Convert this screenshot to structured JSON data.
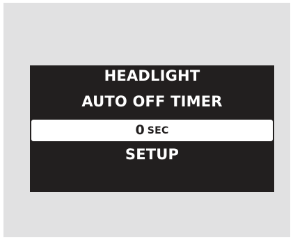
{
  "display": {
    "line1": "HEADLIGHT",
    "line2": "AUTO OFF TIMER",
    "selected": {
      "value": "0",
      "unit": "SEC"
    },
    "line4": "SETUP"
  },
  "colors": {
    "background": "#e1e1e2",
    "screen": "#221f1f",
    "text": "#ffffff",
    "highlight": "#ffffff"
  }
}
